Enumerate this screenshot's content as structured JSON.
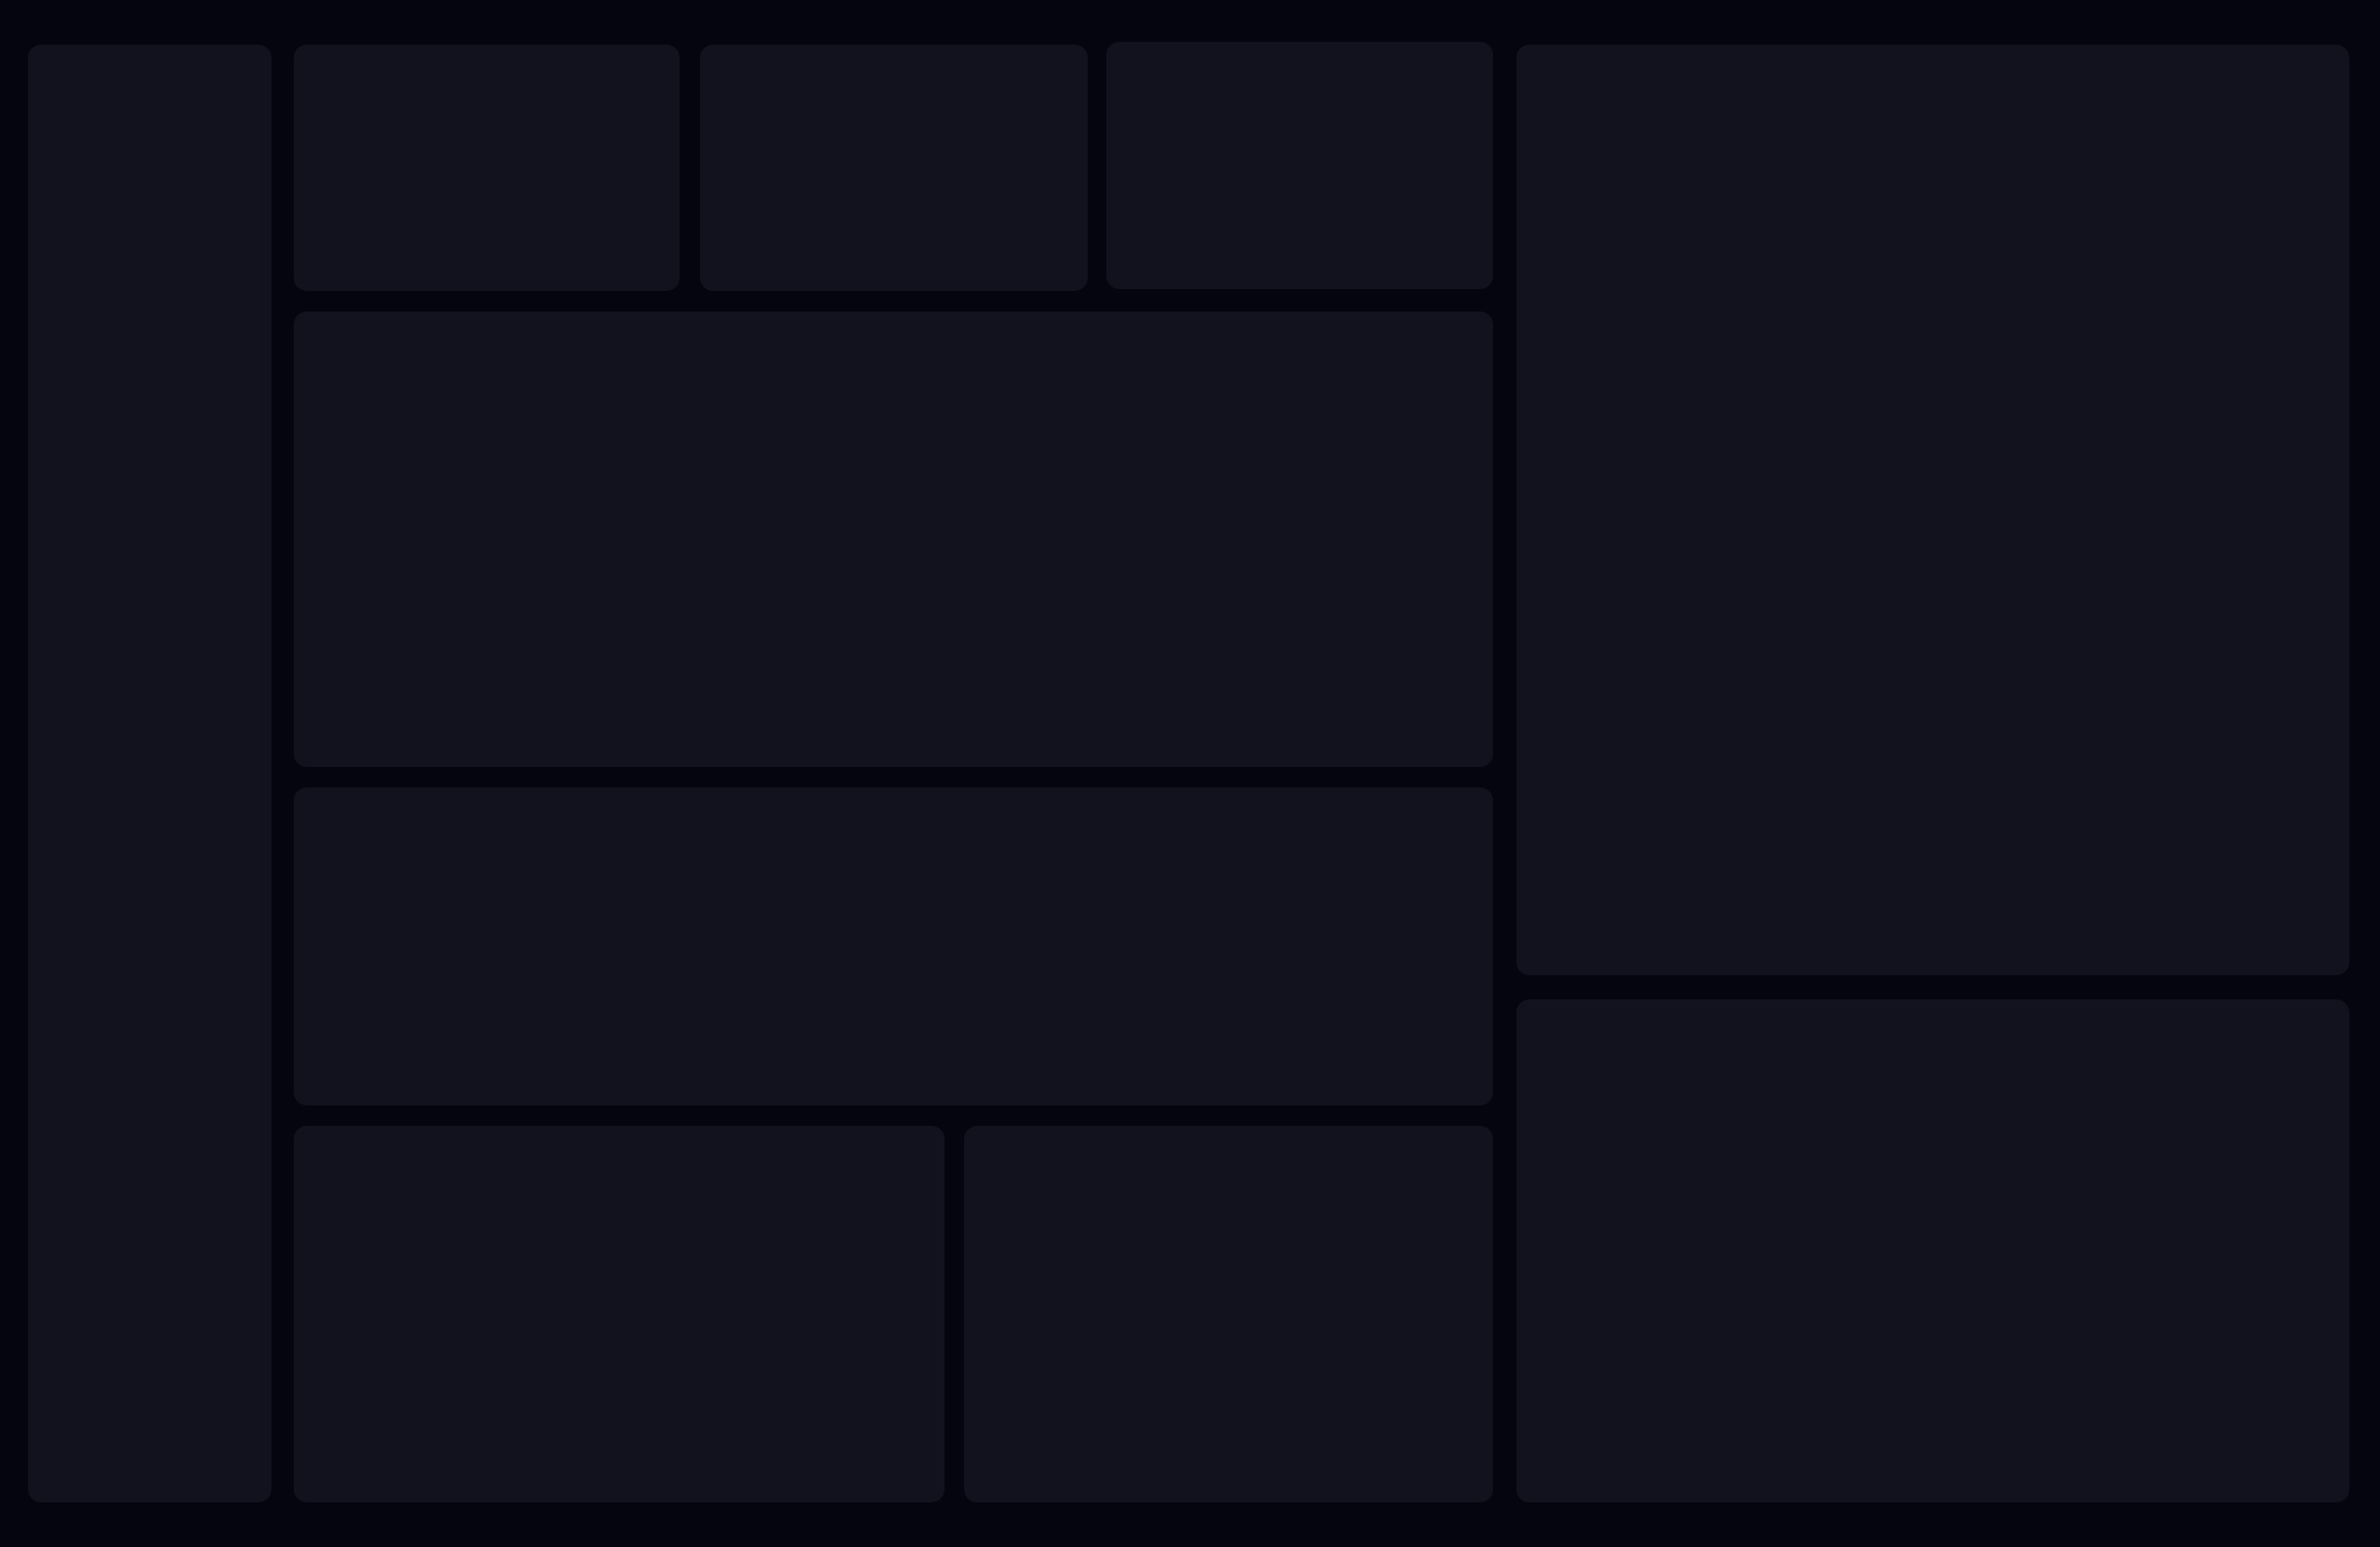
{
  "theme": {
    "background": "#05050f",
    "panel": "#12121e"
  },
  "layout_state": "loading-skeleton",
  "panels": []
}
